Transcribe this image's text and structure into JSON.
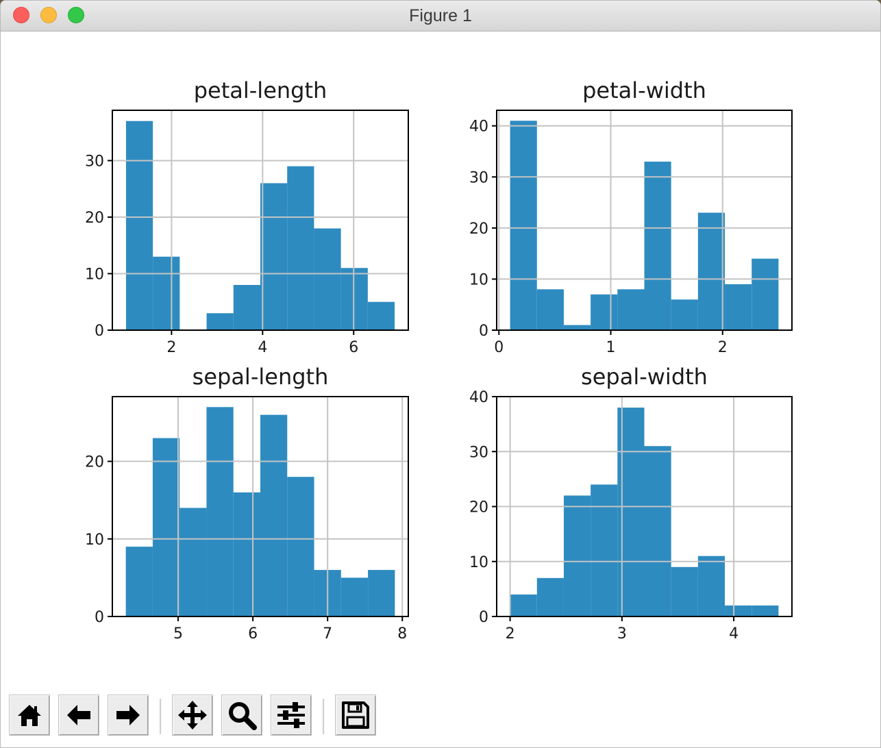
{
  "window": {
    "title": "Figure 1"
  },
  "toolbar": {
    "buttons": [
      {
        "name": "home",
        "icon": "home-icon"
      },
      {
        "name": "back",
        "icon": "arrow-left-icon"
      },
      {
        "name": "forward",
        "icon": "arrow-right-icon"
      },
      {
        "name": "pan",
        "icon": "move-icon"
      },
      {
        "name": "zoom",
        "icon": "magnifier-icon"
      },
      {
        "name": "configure-subplots",
        "icon": "sliders-icon"
      },
      {
        "name": "save",
        "icon": "floppy-disk-icon"
      }
    ]
  },
  "colors": {
    "bar": "#2e8bc0",
    "grid": "#c4c4c4",
    "axis": "#000000"
  },
  "chart_data": [
    {
      "type": "bar",
      "title": "petal-length",
      "bin_edges": [
        1.0,
        1.59,
        2.18,
        2.77,
        3.36,
        3.95,
        4.54,
        5.13,
        5.72,
        6.31,
        6.9
      ],
      "values": [
        37,
        13,
        0,
        3,
        8,
        26,
        29,
        18,
        11,
        5
      ],
      "xlim": [
        0.7,
        7.2
      ],
      "ylim": [
        0,
        38.9
      ],
      "xticks": [
        2,
        4,
        6
      ],
      "yticks": [
        0,
        10,
        20,
        30
      ],
      "grid": true
    },
    {
      "type": "bar",
      "title": "petal-width",
      "bin_edges": [
        0.1,
        0.34,
        0.58,
        0.82,
        1.06,
        1.3,
        1.54,
        1.78,
        2.02,
        2.26,
        2.5
      ],
      "values": [
        41,
        8,
        1,
        7,
        8,
        33,
        6,
        23,
        9,
        14
      ],
      "xlim": [
        -0.02,
        2.62
      ],
      "ylim": [
        0,
        43.05
      ],
      "xticks": [
        0,
        1,
        2
      ],
      "yticks": [
        0,
        10,
        20,
        30,
        40
      ],
      "grid": true
    },
    {
      "type": "bar",
      "title": "sepal-length",
      "bin_edges": [
        4.3,
        4.66,
        5.02,
        5.38,
        5.74,
        6.1,
        6.46,
        6.82,
        7.18,
        7.54,
        7.9
      ],
      "values": [
        9,
        23,
        14,
        27,
        16,
        26,
        18,
        6,
        5,
        6
      ],
      "xlim": [
        4.12,
        8.08
      ],
      "ylim": [
        0,
        28.35
      ],
      "xticks": [
        5,
        6,
        7,
        8
      ],
      "yticks": [
        0,
        10,
        20
      ],
      "grid": true
    },
    {
      "type": "bar",
      "title": "sepal-width",
      "bin_edges": [
        2.0,
        2.24,
        2.48,
        2.72,
        2.96,
        3.2,
        3.44,
        3.68,
        3.92,
        4.16,
        4.4
      ],
      "values": [
        4,
        7,
        22,
        24,
        38,
        31,
        9,
        11,
        2,
        2
      ],
      "xlim": [
        1.88,
        4.52
      ],
      "ylim": [
        0,
        40
      ],
      "xticks": [
        2,
        3,
        4
      ],
      "yticks": [
        0,
        10,
        20,
        30,
        40
      ],
      "grid": true
    }
  ]
}
